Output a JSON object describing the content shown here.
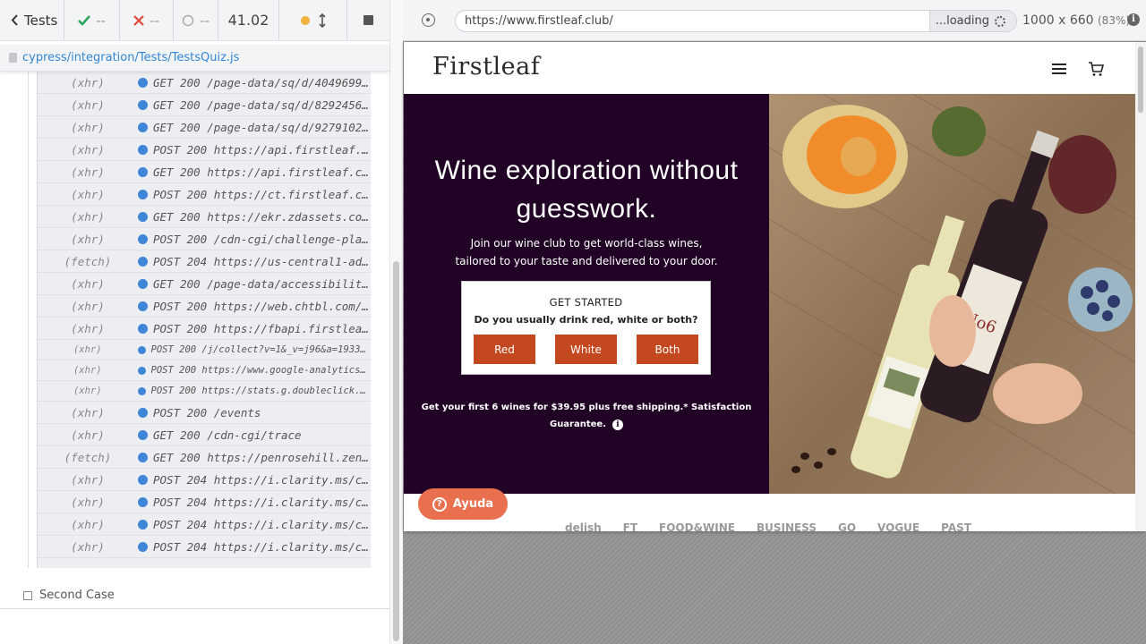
{
  "runner": {
    "back_label": "Tests",
    "passed": "--",
    "failed": "--",
    "pending": "--",
    "duration": "41.02",
    "spec_file": "cypress/integration/Tests/TestsQuiz.js",
    "log": [
      {
        "type": "(xhr)",
        "text": "GET 200 /page-data/sq/d/4049699…",
        "small": false
      },
      {
        "type": "(xhr)",
        "text": "GET 200 /page-data/sq/d/8292456…",
        "small": false
      },
      {
        "type": "(xhr)",
        "text": "GET 200 /page-data/sq/d/9279102…",
        "small": false
      },
      {
        "type": "(xhr)",
        "text": "POST 200 https://api.firstleaf.…",
        "small": false
      },
      {
        "type": "(xhr)",
        "text": "GET 200 https://api.firstleaf.c…",
        "small": false
      },
      {
        "type": "(xhr)",
        "text": "POST 200 https://ct.firstleaf.c…",
        "small": false
      },
      {
        "type": "(xhr)",
        "text": "GET 200 https://ekr.zdassets.co…",
        "small": false
      },
      {
        "type": "(xhr)",
        "text": "POST 200 /cdn-cgi/challenge-pla…",
        "small": false
      },
      {
        "type": "(fetch)",
        "text": "POST 204 https://us-central1-ad…",
        "small": false
      },
      {
        "type": "(xhr)",
        "text": "GET 200 /page-data/accessibilit…",
        "small": false
      },
      {
        "type": "(xhr)",
        "text": "POST 200 https://web.chtbl.com/…",
        "small": false
      },
      {
        "type": "(xhr)",
        "text": "POST 200 https://fbapi.firstlea…",
        "small": false
      },
      {
        "type": "(xhr)",
        "text": "POST 200 /j/collect?v=1&_v=j96&a=19334…",
        "small": true
      },
      {
        "type": "(xhr)",
        "text": "POST 200 https://www.google-analytics.…",
        "small": true
      },
      {
        "type": "(xhr)",
        "text": "POST 200 https://stats.g.doubleclick.n…",
        "small": true
      },
      {
        "type": "(xhr)",
        "text": "POST 200 /events",
        "small": false
      },
      {
        "type": "(xhr)",
        "text": "GET 200 /cdn-cgi/trace",
        "small": false
      },
      {
        "type": "(fetch)",
        "text": "GET 200 https://penrosehill.zen…",
        "small": false
      },
      {
        "type": "(xhr)",
        "text": "POST 204 https://i.clarity.ms/c…",
        "small": false
      },
      {
        "type": "(xhr)",
        "text": "POST 204 https://i.clarity.ms/c…",
        "small": false
      },
      {
        "type": "(xhr)",
        "text": "POST 204 https://i.clarity.ms/c…",
        "small": false
      },
      {
        "type": "(xhr)",
        "text": "POST 204 https://i.clarity.ms/c…",
        "small": false
      }
    ],
    "second_case": "Second Case"
  },
  "browser": {
    "url": "https://www.firstleaf.club/",
    "loading_label": "...loading",
    "viewport": "1000 x 660",
    "zoom": "(83%)"
  },
  "site": {
    "logo": "Firstleaf",
    "hero_title_line1": "Wine exploration without",
    "hero_title_line2": "guesswork.",
    "hero_sub_line1": "Join our wine club to get world-class wines,",
    "hero_sub_line2": "tailored to your taste and delivered to your door.",
    "quiz_title": "GET STARTED",
    "quiz_question": "Do you usually drink red, white or both?",
    "quiz_options": [
      "Red",
      "White",
      "Both"
    ],
    "offer_line1": "Get your first 6 wines for $39.95 plus free shipping.* Satisfaction",
    "offer_line2": "Guarantee.",
    "help_label": "Ayuda",
    "press": [
      "delish",
      "FT",
      "FOOD&WINE",
      "BUSINESS",
      "GQ",
      "VOGUE",
      "PAST"
    ]
  },
  "colors": {
    "hero_bg": "#210326",
    "cta": "#c4481f",
    "help": "#e8704e",
    "link": "#3386d4",
    "pass": "#2aa35a",
    "fail": "#e04a3a"
  }
}
